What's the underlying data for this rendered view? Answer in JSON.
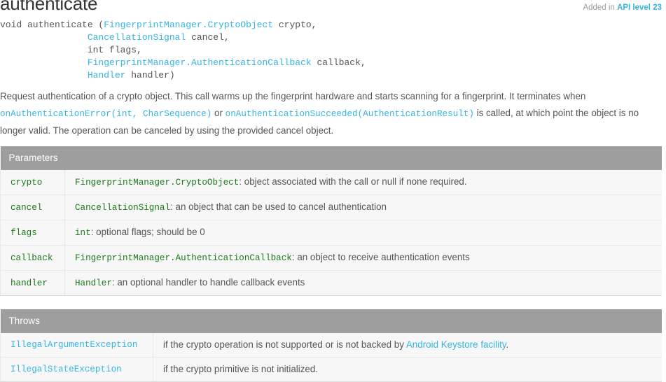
{
  "header": {
    "added_label": "Added in",
    "api_level": "API level 23",
    "member_title": "authenticate"
  },
  "signature": {
    "lines": [
      [
        {
          "text": "void authenticate (",
          "kind": "plain"
        },
        {
          "text": "FingerprintManager.CryptoObject",
          "kind": "link"
        },
        {
          "text": " crypto, ",
          "kind": "plain"
        }
      ],
      [
        {
          "text": "                ",
          "kind": "plain"
        },
        {
          "text": "CancellationSignal",
          "kind": "link"
        },
        {
          "text": " cancel, ",
          "kind": "plain"
        }
      ],
      [
        {
          "text": "                int flags, ",
          "kind": "plain"
        }
      ],
      [
        {
          "text": "                ",
          "kind": "plain"
        },
        {
          "text": "FingerprintManager.AuthenticationCallback",
          "kind": "link"
        },
        {
          "text": " callback, ",
          "kind": "plain"
        }
      ],
      [
        {
          "text": "                ",
          "kind": "plain"
        },
        {
          "text": "Handler",
          "kind": "link"
        },
        {
          "text": " handler)",
          "kind": "plain"
        }
      ]
    ]
  },
  "description": {
    "parts": [
      {
        "text": "Request authentication of a crypto object. This call warms up the fingerprint hardware and starts scanning for a fingerprint. It terminates when ",
        "kind": "plain"
      },
      {
        "text": "onAuthenticationError(int, CharSequence)",
        "kind": "code-link"
      },
      {
        "text": " or ",
        "kind": "plain"
      },
      {
        "text": "onAuthenticationSucceeded(AuthenticationResult)",
        "kind": "code-link"
      },
      {
        "text": " is called, at which point the object is no longer valid. The operation can be canceled by using the provided cancel object.",
        "kind": "plain"
      }
    ]
  },
  "parameters": {
    "heading": "Parameters",
    "rows": [
      {
        "name": "crypto",
        "type": "FingerprintManager.CryptoObject",
        "separator": ": ",
        "desc": "object associated with the call or null if none required."
      },
      {
        "name": "cancel",
        "type": "CancellationSignal",
        "separator": ": ",
        "desc": "an object that can be used to cancel authentication"
      },
      {
        "name": "flags",
        "type": "int",
        "separator": ": ",
        "desc": "optional flags; should be 0"
      },
      {
        "name": "callback",
        "type": "FingerprintManager.AuthenticationCallback",
        "separator": ": ",
        "desc": "an object to receive authentication events"
      },
      {
        "name": "handler",
        "type": "Handler",
        "separator": ": ",
        "desc": "an optional handler to handle callback events"
      }
    ]
  },
  "throws": {
    "heading": "Throws",
    "rows": [
      {
        "name": "IllegalArgumentException",
        "desc_before": "if the crypto operation is not supported or is not backed by ",
        "desc_link": "Android Keystore facility",
        "desc_after": "."
      },
      {
        "name": "IllegalStateException",
        "desc_before": "if the crypto primitive is not initialized.",
        "desc_link": "",
        "desc_after": ""
      }
    ]
  },
  "colors": {
    "link_blue": "#33b5e5",
    "code_green": "#1a7a1a",
    "table_header_gray": "#9e9e9e",
    "table_row_bg": "#f7f7f7",
    "body_text": "#555555"
  }
}
